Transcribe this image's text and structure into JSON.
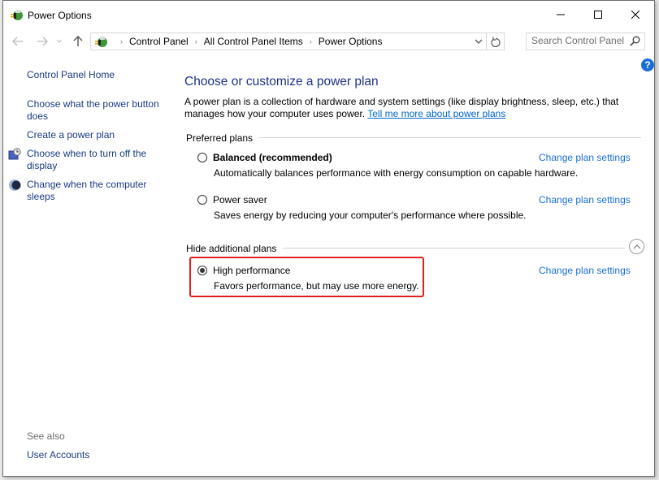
{
  "window": {
    "title": "Power Options",
    "controls": {
      "minimize": "minimize",
      "maximize": "maximize",
      "close": "close"
    }
  },
  "nav": {
    "back": "back",
    "forward": "forward",
    "recent": "recent-locations",
    "up": "up",
    "breadcrumb": [
      "Control Panel",
      "All Control Panel Items",
      "Power Options"
    ],
    "search_placeholder": "Search Control Panel"
  },
  "sidebar": {
    "home": "Control Panel Home",
    "links": [
      {
        "label": "Choose what the power button does",
        "icon": null
      },
      {
        "label": "Create a power plan",
        "icon": null
      },
      {
        "label": "Choose when to turn off the display",
        "icon": "display-clock-icon"
      },
      {
        "label": "Change when the computer sleeps",
        "icon": "sleep-moon-icon"
      }
    ],
    "see_also": "See also",
    "see_also_links": [
      "User Accounts"
    ]
  },
  "main": {
    "heading": "Choose or customize a power plan",
    "description": "A power plan is a collection of hardware and system settings (like display brightness, sleep, etc.) that manages how your computer uses power.",
    "learn_more": "Tell me more about power plans",
    "preferred_label": "Preferred plans",
    "additional_label": "Hide additional plans",
    "change_label": "Change plan settings",
    "plans": [
      {
        "name": "Balanced (recommended)",
        "description": "Automatically balances performance with energy consumption on capable hardware.",
        "selected": false,
        "bold": true
      },
      {
        "name": "Power saver",
        "description": "Saves energy by reducing your computer's performance where possible.",
        "selected": false,
        "bold": false
      },
      {
        "name": "High performance",
        "description": "Favors performance, but may use more energy.",
        "selected": true,
        "bold": false
      }
    ]
  },
  "colors": {
    "link": "#1a6ed8",
    "heading": "#1e3287",
    "highlight": "#e02020"
  }
}
